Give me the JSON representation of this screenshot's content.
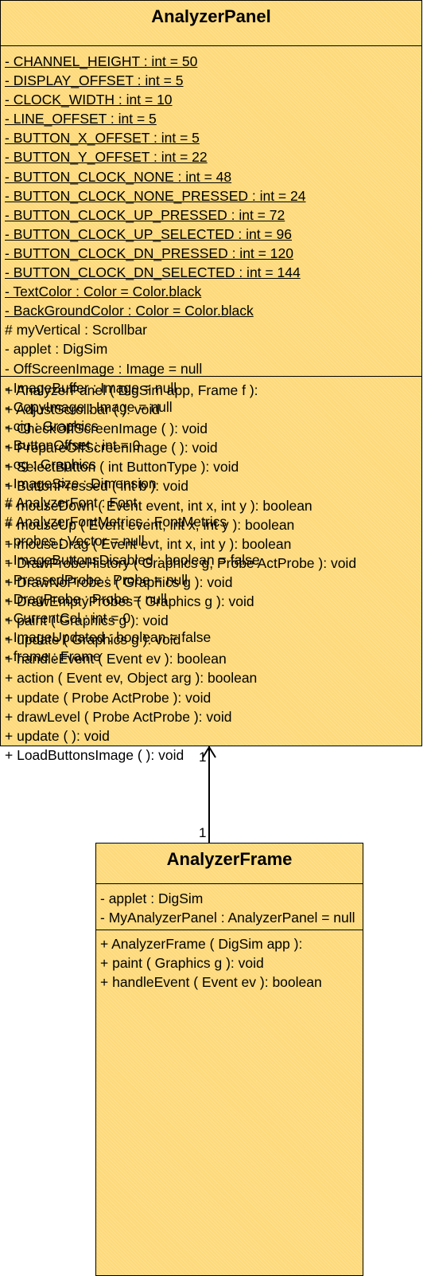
{
  "analyzer_panel": {
    "name": "AnalyzerPanel",
    "attributes": [
      {
        "text": "- CHANNEL_HEIGHT : int = 50",
        "static": true
      },
      {
        "text": "- DISPLAY_OFFSET : int = 5",
        "static": true
      },
      {
        "text": "- CLOCK_WIDTH : int = 10",
        "static": true
      },
      {
        "text": "- LINE_OFFSET : int = 5",
        "static": true
      },
      {
        "text": "- BUTTON_X_OFFSET : int = 5",
        "static": true
      },
      {
        "text": "- BUTTON_Y_OFFSET : int = 22",
        "static": true
      },
      {
        "text": "- BUTTON_CLOCK_NONE : int = 48",
        "static": true
      },
      {
        "text": "- BUTTON_CLOCK_NONE_PRESSED : int = 24",
        "static": true
      },
      {
        "text": "- BUTTON_CLOCK_UP_PRESSED : int = 72",
        "static": true
      },
      {
        "text": "- BUTTON_CLOCK_UP_SELECTED : int = 96",
        "static": true
      },
      {
        "text": "- BUTTON_CLOCK_DN_PRESSED : int = 120",
        "static": true
      },
      {
        "text": "- BUTTON_CLOCK_DN_SELECTED : int = 144",
        "static": true
      },
      {
        "text": "- TextColor : Color = Color.black",
        "static": true
      },
      {
        "text": "- BackGroundColor : Color = Color.black",
        "static": true
      },
      {
        "text": "# myVertical : Scrollbar",
        "static": false
      },
      {
        "text": "- applet : DigSim",
        "static": false
      },
      {
        "text": "- OffScreenImage : Image = null",
        "static": false
      },
      {
        "text": "- ImageBuffer : Image = null",
        "static": false
      },
      {
        "text": "- CopyImage : Image = null",
        "static": false
      },
      {
        "text": "- cig : Graphics",
        "static": false
      },
      {
        "text": "- ButtonOffset : int = 0",
        "static": false
      },
      {
        "text": "- og : Graphics",
        "static": false
      },
      {
        "text": "- ImageSize : Dimension",
        "static": false
      },
      {
        "text": "# AnalyzerFont : Font",
        "static": false
      },
      {
        "text": "# AnalyzerFontMetrics : FontMetrics",
        "static": false
      },
      {
        "text": "- probes : Vector = null",
        "static": false
      },
      {
        "text": "- ImageButtonsDisabled : boolean = false",
        "static": false
      },
      {
        "text": "- PressedProbe : Probe = null",
        "static": false
      },
      {
        "text": "- DragProbe : Probe = null",
        "static": false
      },
      {
        "text": "- CurrentCol : int = 0",
        "static": false
      },
      {
        "text": "- ImageUpdated : boolean = false",
        "static": false
      },
      {
        "text": "- frame : Frame",
        "static": false
      }
    ],
    "operations": [
      "+ AnalyzerPanel ( DigSim app, Frame f ):",
      "+ AdjustScrollbar ( ): void",
      "+ CheckOffScreenImage ( ): void",
      "+ PrepareOffScreenImage ( ): void",
      "+ SelectButton ( int ButtonType ): void",
      "+ ButtonPressed ( int b ): void",
      "+ mouseDown ( Event event, int x, int y ): boolean",
      "+ mouseUp ( Event event, int x, int y ): boolean",
      "+ mouseDrag ( Event evt, int x, int y ): boolean",
      "+ DrawProbeHistory ( Graphics g, Probe ActProbe ): void",
      "+ DrawNoProbes ( Graphics g ): void",
      "+ DrawEmptyProbes ( Graphics g ): void",
      "+ paint ( Graphics g ): void",
      "+ update ( Graphics g ): void",
      "+ handleEvent ( Event ev ): boolean",
      "+ action ( Event ev, Object arg ): boolean",
      "+ update ( Probe ActProbe ): void",
      "+ drawLevel ( Probe ActProbe ): void",
      "+ update ( ): void",
      "+ LoadButtonsImage ( ): void"
    ]
  },
  "analyzer_frame": {
    "name": "AnalyzerFrame",
    "attributes": [
      {
        "text": "- applet : DigSim",
        "static": false
      },
      {
        "text": "- MyAnalyzerPanel : AnalyzerPanel = null",
        "static": false
      }
    ],
    "operations": [
      "+ AnalyzerFrame ( DigSim app ):",
      "+ paint ( Graphics g ): void",
      "+ handleEvent ( Event ev ): boolean"
    ]
  },
  "association": {
    "multiplicity_panel_end": "1",
    "multiplicity_frame_end": "1"
  },
  "colors": {
    "class_fill": "#fdd979",
    "line": "#000000"
  }
}
